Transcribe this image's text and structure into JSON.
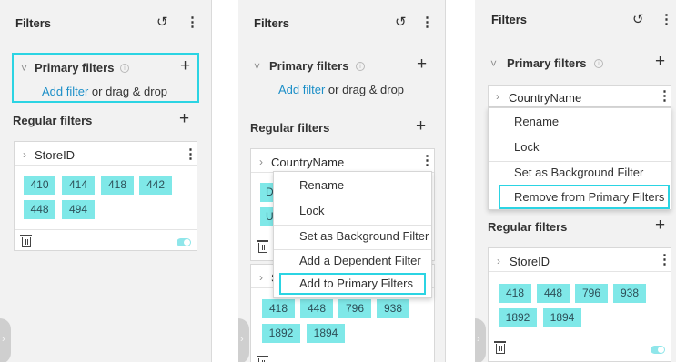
{
  "panel": {
    "title": "Filters",
    "reset_icon": "reset-icon",
    "more_icon": "more-icon",
    "primary_label": "Primary filters",
    "add_filter": "Add filter",
    "drag_drop": " or drag & drop",
    "regular_label": "Regular filters",
    "expand_tab": "›"
  },
  "glyphs": {
    "reset": "↺",
    "more": "⋮",
    "plus": "+",
    "chev_down": "˅",
    "chev_right": "›",
    "info": "i"
  },
  "colors": {
    "highlight": "#2bd4e3",
    "chip": "#7fe8e8",
    "link": "#1c8fc8"
  },
  "panel1": {
    "card_title": "StoreID",
    "chips": [
      "410",
      "414",
      "418",
      "442",
      "448",
      "494"
    ]
  },
  "panel2": {
    "card_title": "CountryName",
    "peek_chars": [
      "D",
      "U"
    ],
    "menu": [
      "Rename",
      "Lock",
      "Set as Background Filter",
      "Add a Dependent Filter",
      "Add to Primary Filters"
    ],
    "lower_card_peek": "S",
    "chips": [
      "418",
      "448",
      "796",
      "938",
      "1892",
      "1894"
    ]
  },
  "panel3": {
    "primary_card_title": "CountryName",
    "menu": [
      "Rename",
      "Lock",
      "Set as Background Filter",
      "Remove from Primary Filters"
    ],
    "card_title": "StoreID",
    "chips": [
      "418",
      "448",
      "796",
      "938",
      "1892",
      "1894"
    ]
  }
}
